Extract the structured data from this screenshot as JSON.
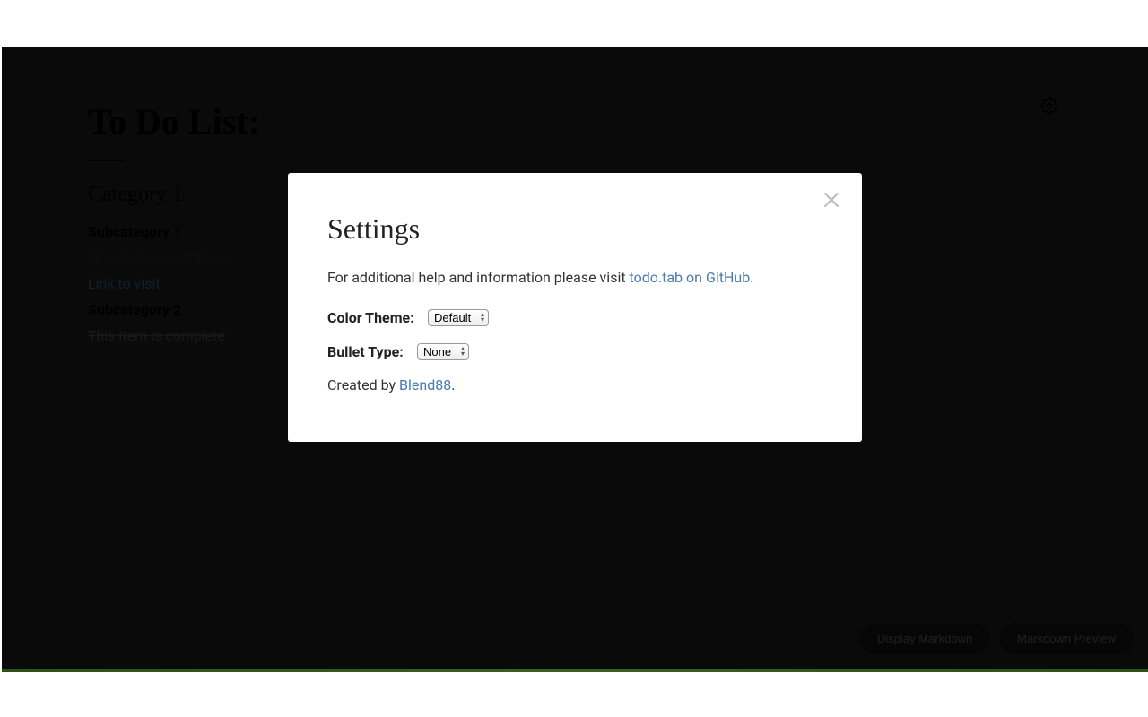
{
  "page": {
    "title": "To Do List:",
    "category": "Category 1",
    "subcategory1": "Subcategory 1",
    "item1": "First item to complete",
    "link_item": "Link to visit",
    "subcategory2": "Subcategory 2",
    "complete_item": "This item is complete"
  },
  "footer": {
    "display_markdown": "Display Markdown",
    "markdown_preview": "Markdown Preview"
  },
  "modal": {
    "title": "Settings",
    "help_prefix": "For additional help and information please visit ",
    "help_link": "todo.tab on GitHub",
    "help_suffix": ".",
    "color_theme_label": "Color Theme:",
    "color_theme_value": "Default",
    "bullet_type_label": "Bullet Type:",
    "bullet_type_value": "None",
    "created_prefix": "Created by ",
    "created_link": "Blend88",
    "created_suffix": "."
  }
}
